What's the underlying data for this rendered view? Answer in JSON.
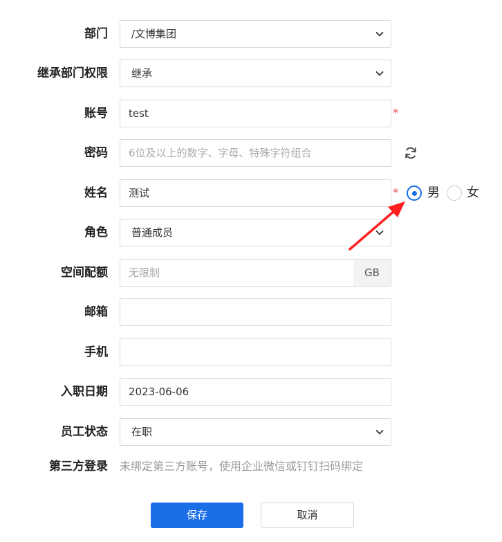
{
  "form": {
    "department": {
      "label": "部门",
      "value": "/文博集团"
    },
    "inherit": {
      "label": "继承部门权限",
      "value": "继承"
    },
    "account": {
      "label": "账号",
      "value": "test",
      "required": "*"
    },
    "password": {
      "label": "密码",
      "placeholder": "6位及以上的数字、字母、特殊字符组合",
      "refresh_icon": "refresh-icon"
    },
    "name": {
      "label": "姓名",
      "value": "测试",
      "required": "*",
      "gender_options": [
        "男",
        "女"
      ],
      "gender_selected": "男"
    },
    "role": {
      "label": "角色",
      "value": "普通成员"
    },
    "quota": {
      "label": "空间配额",
      "placeholder": "无限制",
      "unit": "GB"
    },
    "email": {
      "label": "邮箱",
      "value": ""
    },
    "phone": {
      "label": "手机",
      "value": ""
    },
    "hire_date": {
      "label": "入职日期",
      "value": "2023-06-06"
    },
    "status": {
      "label": "员工状态",
      "value": "在职"
    },
    "third_party": {
      "label": "第三方登录",
      "hint": "未绑定第三方账号，使用企业微信或钉钉扫码绑定"
    }
  },
  "buttons": {
    "save": "保存",
    "cancel": "取消"
  },
  "colors": {
    "primary": "#1a6ee8",
    "required": "#e35151",
    "annotation_arrow": "#ff1f1f"
  }
}
